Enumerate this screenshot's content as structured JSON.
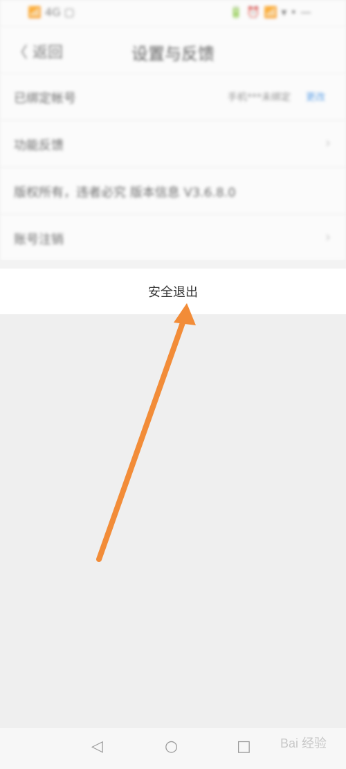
{
  "status_bar": {
    "left": "📶 4G ▢",
    "right": "🔋 ⏰ 📶 ▾ • —"
  },
  "header": {
    "back_label": "〈 返回",
    "title": "设置与反馈"
  },
  "rows": [
    {
      "label": "已绑定帐号",
      "value": "手机***未绑定",
      "action": "更改"
    },
    {
      "label": "功能反馈",
      "chevron": "›"
    },
    {
      "label": "版权所有，违者必究 版本信息 V3.6.8.0",
      "value": ""
    },
    {
      "label": "账号注销",
      "chevron": "›"
    }
  ],
  "logout_label": "安全退出",
  "nav": {
    "back": "◁",
    "home": "○",
    "recent": "□"
  },
  "watermark": "Bai 经验",
  "colors": {
    "arrow": "#f28c38",
    "link": "#3a8ee6"
  }
}
